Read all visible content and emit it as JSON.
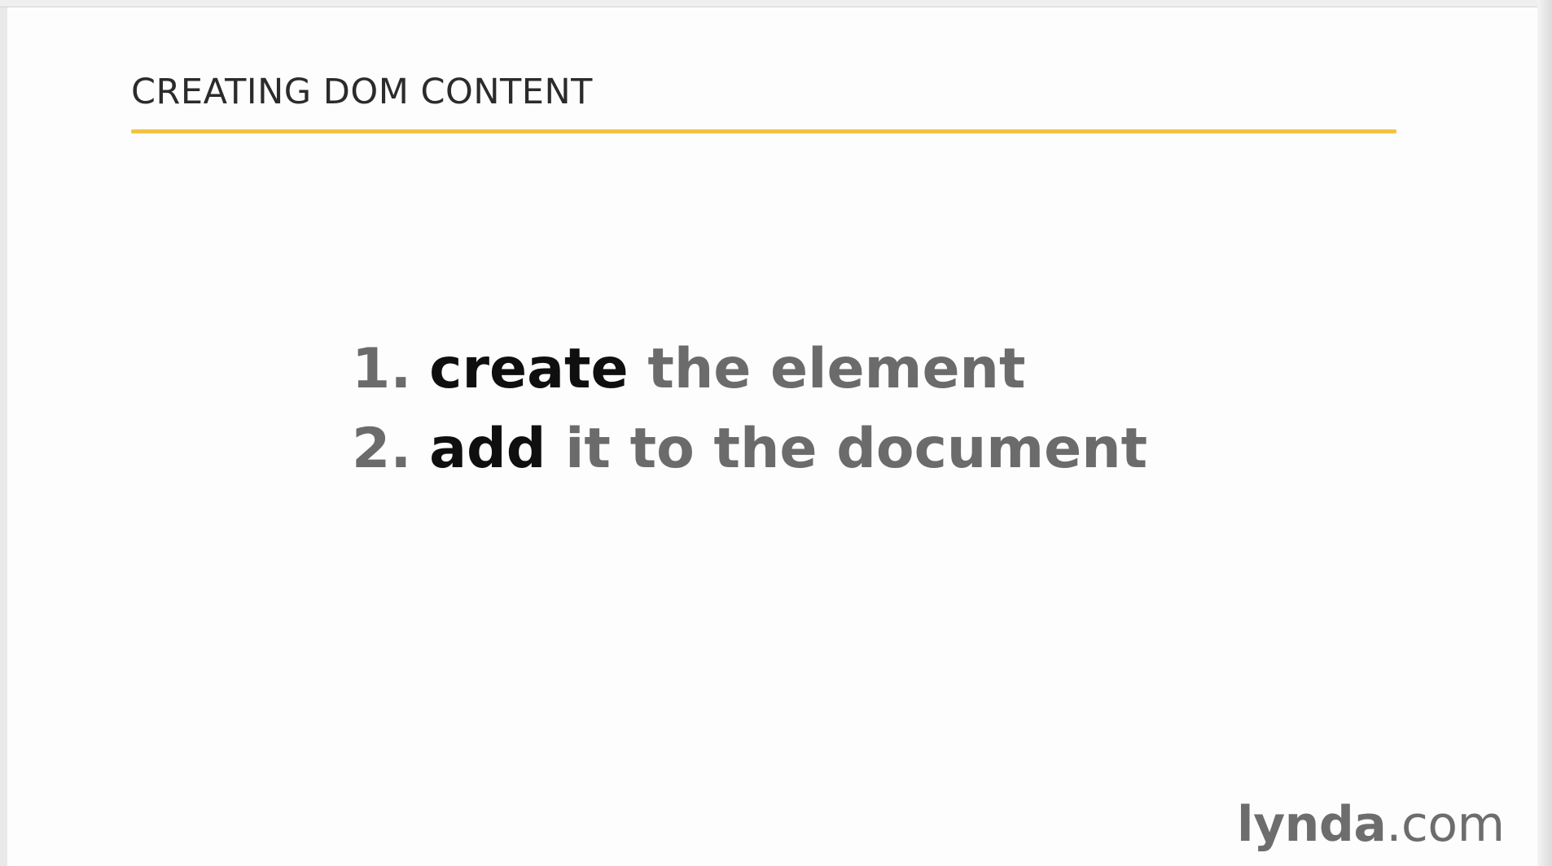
{
  "slide": {
    "title": "CREATING DOM CONTENT",
    "steps": [
      {
        "number": "1.",
        "verb": "create",
        "rest": "the element"
      },
      {
        "number": "2.",
        "verb": "add",
        "rest": "it to the document"
      }
    ]
  },
  "branding": {
    "logo_main": "lynda",
    "logo_suffix": ".com"
  },
  "colors": {
    "accent_rule": "#f3c244",
    "title_text": "#2b2b2b",
    "verb_text": "#0f0f0f",
    "muted_text": "#6b6b6b"
  }
}
